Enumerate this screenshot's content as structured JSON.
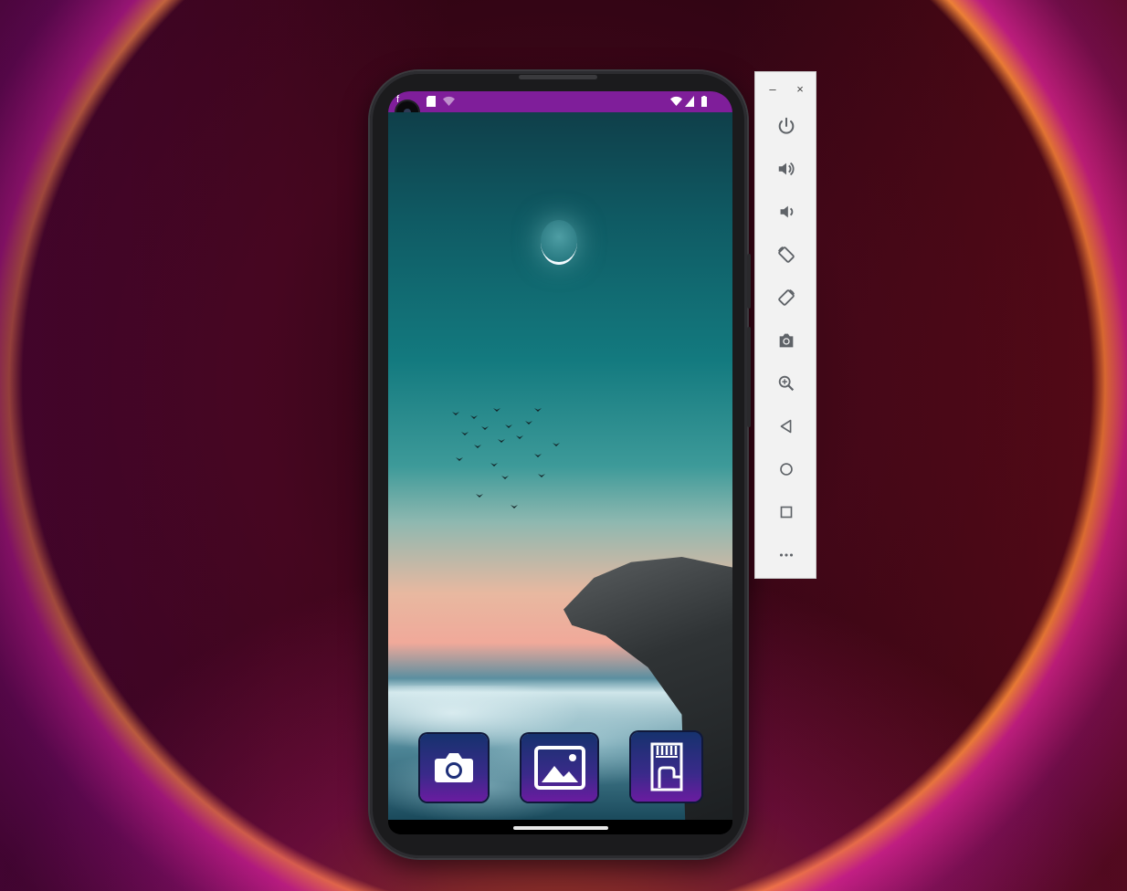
{
  "window": {
    "minimize_glyph": "–",
    "close_glyph": "×"
  },
  "toolbar": {
    "buttons": [
      {
        "name": "power-button",
        "icon": "power-icon"
      },
      {
        "name": "volume-up-button",
        "icon": "volume-up-icon"
      },
      {
        "name": "volume-down-button",
        "icon": "volume-down-icon"
      },
      {
        "name": "rotate-left-button",
        "icon": "rotate-left-icon"
      },
      {
        "name": "rotate-right-button",
        "icon": "rotate-right-icon"
      },
      {
        "name": "screenshot-button",
        "icon": "camera-icon"
      },
      {
        "name": "zoom-button",
        "icon": "zoom-in-icon"
      },
      {
        "name": "back-button",
        "icon": "back-triangle-icon"
      },
      {
        "name": "home-button",
        "icon": "home-circle-icon"
      },
      {
        "name": "overview-button",
        "icon": "overview-square-icon"
      },
      {
        "name": "more-button",
        "icon": "more-dots-icon"
      }
    ],
    "icon_color": "#5f6368"
  },
  "phone": {
    "status_bar": {
      "left_glyph": "f",
      "icons": [
        "sd-card-icon",
        "wifi-question-icon",
        "wifi-icon",
        "signal-icon",
        "battery-icon"
      ],
      "color": "#7f1e9a"
    },
    "apps": [
      {
        "name": "camera-app-button",
        "icon": "camera-icon"
      },
      {
        "name": "gallery-app-button",
        "icon": "image-icon"
      },
      {
        "name": "sd-card-app-button",
        "icon": "sd-card-icon"
      }
    ]
  }
}
